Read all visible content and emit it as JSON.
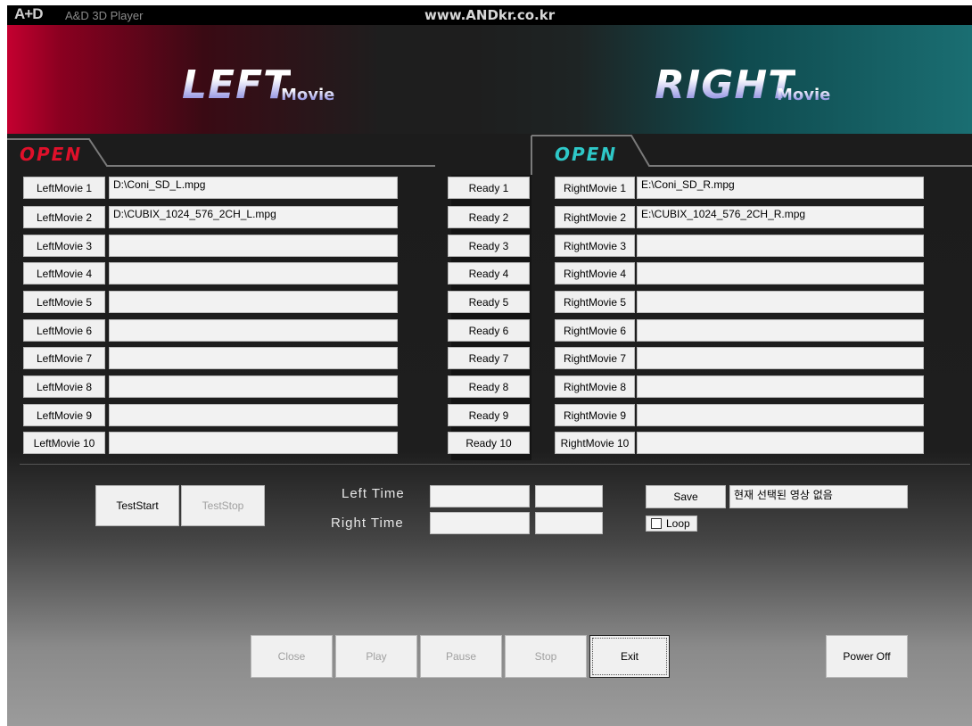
{
  "titlebar": {
    "logo": "A+D",
    "app_title": "A&D 3D Player",
    "url": "www.ANDkr.co.kr"
  },
  "banner": {
    "left": {
      "big": "LEFT",
      "small": "Movie"
    },
    "right": {
      "big": "RIGHT",
      "small": "Movie"
    }
  },
  "open_left": {
    "label": "OPEN",
    "color": "#e0102a"
  },
  "open_right": {
    "label": "OPEN",
    "color": "#2ec8c8"
  },
  "left_buttons": [
    "LeftMovie 1",
    "LeftMovie 2",
    "LeftMovie 3",
    "LeftMovie 4",
    "LeftMovie 5",
    "LeftMovie 6",
    "LeftMovie 7",
    "LeftMovie 8",
    "LeftMovie 9",
    "LeftMovie 10"
  ],
  "left_paths": [
    "D:\\Coni_SD_L.mpg",
    "D:\\CUBIX_1024_576_2CH_L.mpg",
    "",
    "",
    "",
    "",
    "",
    "",
    "",
    ""
  ],
  "ready_buttons": [
    "Ready 1",
    "Ready 2",
    "Ready 3",
    "Ready 4",
    "Ready 5",
    "Ready 6",
    "Ready 7",
    "Ready 8",
    "Ready 9",
    "Ready 10"
  ],
  "right_buttons": [
    "RightMovie 1",
    "RightMovie 2",
    "RightMovie 3",
    "RightMovie 4",
    "RightMovie 5",
    "RightMovie 6",
    "RightMovie 7",
    "RightMovie 8",
    "RightMovie 9",
    "RightMovie 10"
  ],
  "right_paths": [
    "E:\\Coni_SD_R.mpg",
    "E:\\CUBIX_1024_576_2CH_R.mpg",
    "",
    "",
    "",
    "",
    "",
    "",
    "",
    ""
  ],
  "controls": {
    "test_start": "TestStart",
    "test_stop": "TestStop",
    "left_time_label": "Left Time",
    "right_time_label": "Right Time",
    "left_time_1": "",
    "left_time_2": "",
    "right_time_1": "",
    "right_time_2": "",
    "save": "Save",
    "status": "현재 선택된 영상 없음",
    "loop": "Loop"
  },
  "transport": {
    "close": "Close",
    "play": "Play",
    "pause": "Pause",
    "stop": "Stop",
    "exit": "Exit",
    "power_off": "Power Off"
  }
}
